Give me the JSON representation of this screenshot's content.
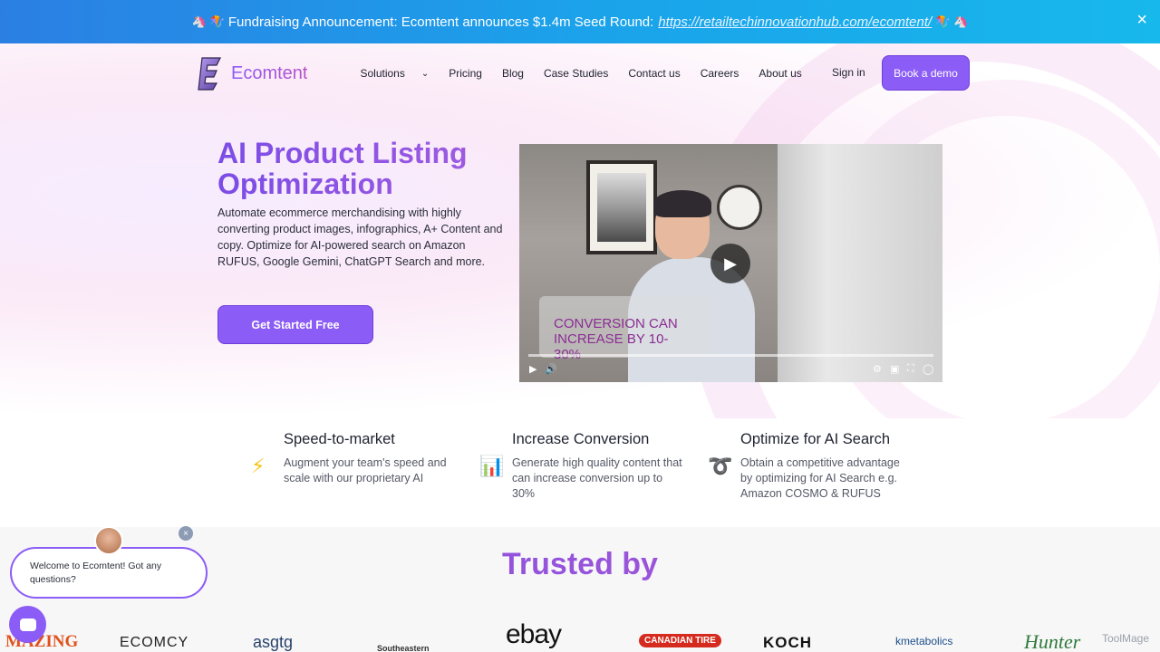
{
  "announcement": {
    "text": "Fundraising Announcement: Ecomtent announces $1.4m Seed Round:",
    "link": "https://retailtechinnovationhub.com/ecomtent/",
    "emoji_left": "🦄 🪁",
    "emoji_right": "🪁 🦄",
    "close_icon": "×"
  },
  "nav": {
    "brand": "Ecomtent",
    "items": [
      {
        "label": "Solutions",
        "has_dropdown": true
      },
      {
        "label": "Pricing"
      },
      {
        "label": "Blog"
      },
      {
        "label": "Case Studies"
      },
      {
        "label": "Contact us"
      },
      {
        "label": "Careers"
      },
      {
        "label": "About us"
      }
    ],
    "sign_in": "Sign in",
    "book_demo": "Book a demo"
  },
  "hero": {
    "title": "AI Product Listing Optimization",
    "description": "Automate ecommerce merchandising with highly converting product images, infographics, A+ Content and copy. Optimize for AI-powered search on Amazon RUFUS, Google Gemini, ChatGPT Search and more.",
    "cta": "Get Started Free",
    "video_caption": "CONVERSION CAN INCREASE BY 10-30%"
  },
  "features": [
    {
      "icon": "lightning-icon",
      "glyph": "⚡",
      "title": "Speed-to-market",
      "description": "Augment your team's speed and scale with our proprietary AI"
    },
    {
      "icon": "bar-chart-icon",
      "glyph": "📊",
      "title": "Increase Conversion",
      "description": "Generate high quality content that can increase conversion up to 30%"
    },
    {
      "icon": "knot-icon",
      "glyph": "➰",
      "title": "Optimize for AI Search",
      "description": "Obtain a competitive advantage by optimizing for AI Search e.g. Amazon COSMO & RUFUS"
    }
  ],
  "trusted": {
    "title": "Trusted by",
    "logos": [
      "MAZING",
      "ECOMCY",
      "asgtg",
      "Southeastern",
      "ebay",
      "CANADIAN TIRE",
      "KOCH",
      "kmetabolics",
      "Hunter"
    ]
  },
  "chat": {
    "message": "Welcome to Ecomtent! Got any questions?",
    "close": "×"
  },
  "watermark": "ToolMage",
  "colors": {
    "accent": "#8b5cf6",
    "announce": "#1ba2ea"
  }
}
